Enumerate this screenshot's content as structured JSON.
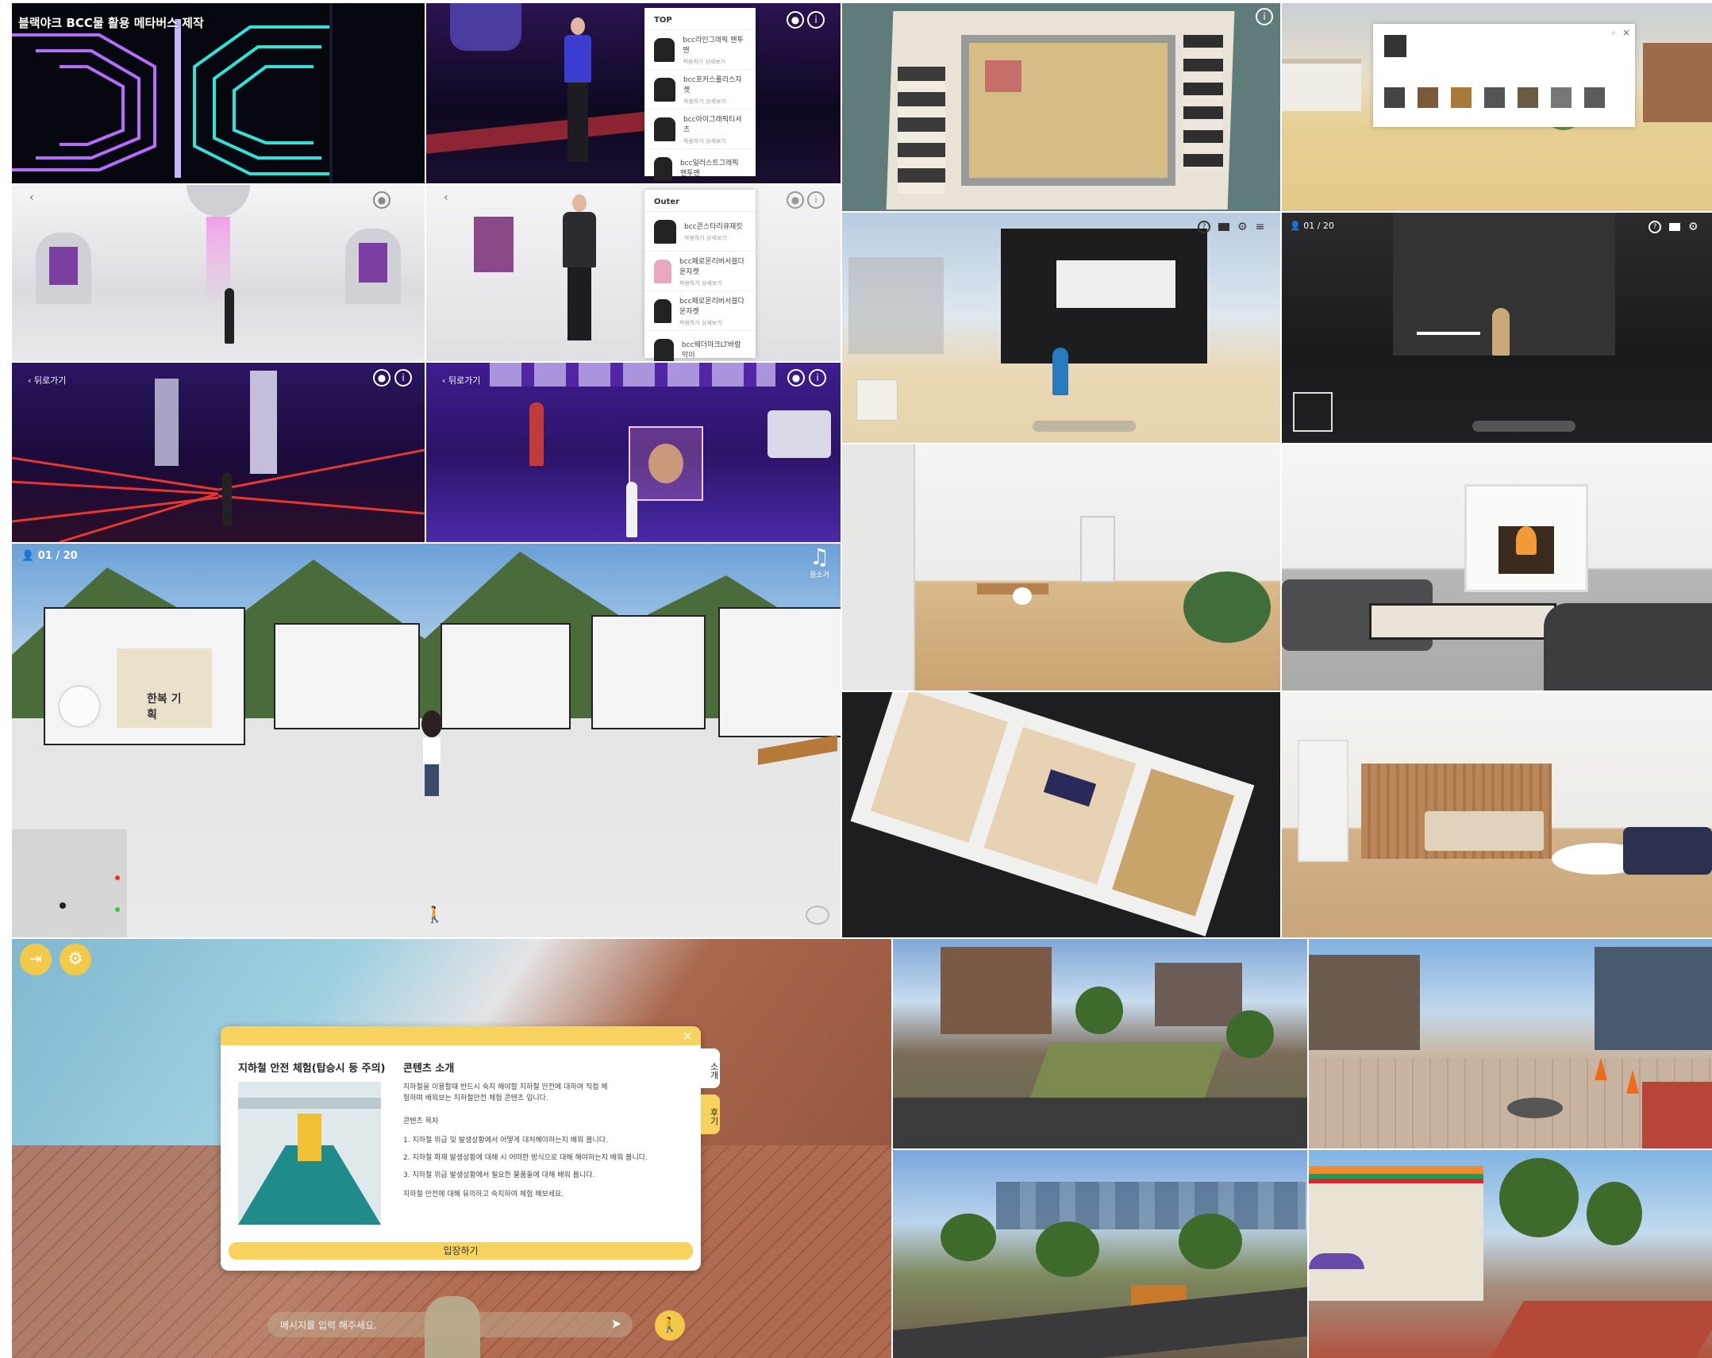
{
  "tiles": {
    "neon_tunnel": {
      "title": "블랙야크 BCC물 활용 메타버스 제작"
    },
    "top_store": {
      "panel_title": "TOP",
      "items": [
        {
          "name": "bcc라인그래픽 맨투맨",
          "sub": "착용하기  상세보기"
        },
        {
          "name": "bcc포커스플리스자켓",
          "sub": "착용하기  상세보기"
        },
        {
          "name": "bcc아이그래픽티셔츠",
          "sub": "착용하기  상세보기"
        },
        {
          "name": "bcc일러스트그래픽 맨투맨",
          "sub": ""
        }
      ]
    },
    "outer_store": {
      "panel_title": "Outer",
      "items": [
        {
          "name": "bcc콘스타리큐재킷",
          "sub": "착용하기  상세보기"
        },
        {
          "name": "bcc페로몬리버서블다운자켓",
          "sub": "착용하기  상세보기"
        },
        {
          "name": "bcc페로몬리버서블다운자켓",
          "sub": "착용하기  상세보기"
        },
        {
          "name": "bcc웨더마크LT바람막이",
          "sub": ""
        }
      ]
    },
    "laser_hall": {
      "back_label": "뒤로가기"
    },
    "purple_hall": {
      "back_label": "뒤로가기"
    },
    "exhibition_dark": {
      "user_count": "01 / 20"
    },
    "exhibition_plaza": {
      "user_count": "01 / 20",
      "music_label": "음소거"
    },
    "subway_modal": {
      "modal_title": "지하철 안전 체험(탑승시 등 주의)",
      "intro_title": "콘텐츠 소개",
      "intro_text": "지하철을 이용할때 반드시 숙지 해야할 지하철 안전에 대하여 직접 체험하며 배워보는 지하철안전 체험 콘텐츠 입니다.",
      "points_title": "콘텐츠 목차",
      "points": [
        "1. 지하철 위급 및 발생상황에서 어떻게 대처해야하는지 배워 봅니다.",
        "2. 지하철 화재 발생상황에 대해 시 어떠한 방식으로 대해 해야하는지 배워 봅니다.",
        "3. 지하철 위급 발생상황에서 필요한 물품들에 대해 배워 봅니다."
      ],
      "closing": "지하철 안전에 대해 유의하고 숙지하여 체험 해보세요.",
      "side_tab_1": "소개",
      "side_tab_2": "후기",
      "enter_button": "입장하기",
      "chat_placeholder": "메시지를 입력 해주세요."
    },
    "booth_sign": "한복 기획"
  },
  "colors": {
    "neon_purple": "#b56cff",
    "neon_cyan": "#2fe3d8",
    "laser_red": "#ff3b2f",
    "modal_yellow": "#f7d25e",
    "night_purple": "#5a2bb0"
  }
}
